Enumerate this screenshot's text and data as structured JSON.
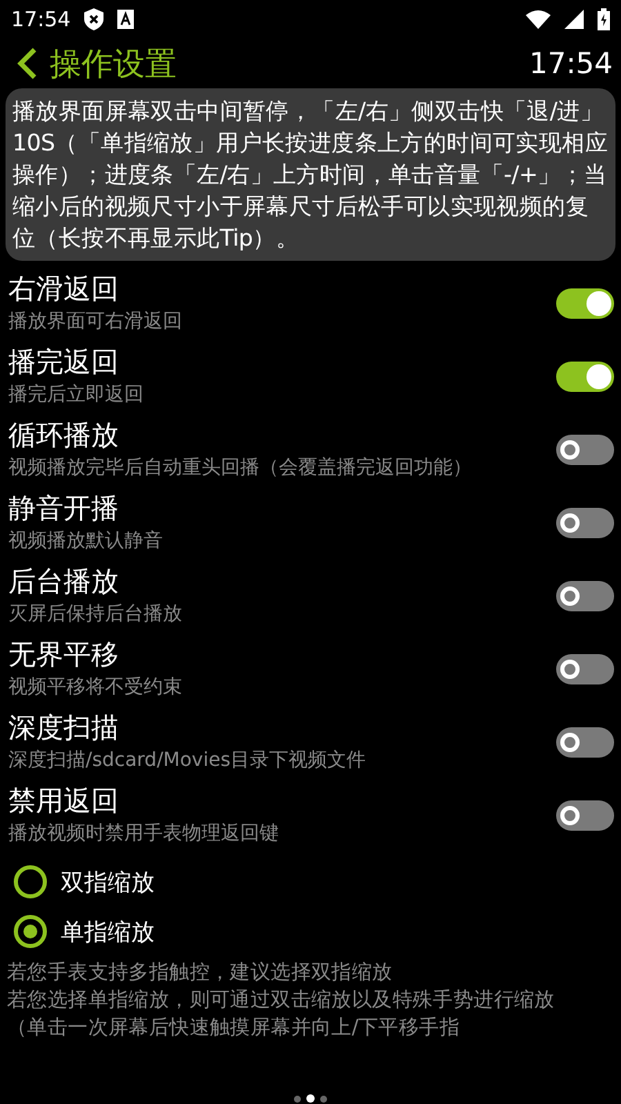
{
  "status_bar": {
    "time": "17:54"
  },
  "header": {
    "title": "操作设置",
    "time": "17:54"
  },
  "tip": "播放界面屏幕双击中间暂停，「左/右」侧双击快「退/进」10S（「单指缩放」用户长按进度条上方的时间可实现相应操作）；进度条「左/右」上方时间，单击音量「-/+」；当缩小后的视频尺寸小于屏幕尺寸后松手可以实现视频的复位（长按不再显示此Tip）。",
  "settings": [
    {
      "title": "右滑返回",
      "subtitle": "播放界面可右滑返回",
      "on": true
    },
    {
      "title": "播完返回",
      "subtitle": "播完后立即返回",
      "on": true
    },
    {
      "title": "循环播放",
      "subtitle": "视频播放完毕后自动重头回播（会覆盖播完返回功能）",
      "on": false
    },
    {
      "title": "静音开播",
      "subtitle": "视频播放默认静音",
      "on": false
    },
    {
      "title": "后台播放",
      "subtitle": "灭屏后保持后台播放",
      "on": false
    },
    {
      "title": "无界平移",
      "subtitle": "视频平移将不受约束",
      "on": false
    },
    {
      "title": "深度扫描",
      "subtitle": "深度扫描/sdcard/Movies目录下视频文件",
      "on": false
    },
    {
      "title": "禁用返回",
      "subtitle": "播放视频时禁用手表物理返回键",
      "on": false
    }
  ],
  "zoom_modes": [
    {
      "label": "双指缩放",
      "selected": false
    },
    {
      "label": "单指缩放",
      "selected": true
    }
  ],
  "notes": [
    "若您手表支持多指触控，建议选择双指缩放",
    "若您选择单指缩放，则可通过双击缩放以及特殊手势进行缩放",
    "（单击一次屏幕后快速触摸屏幕并向上/下平移手指"
  ],
  "page_dots": [
    {
      "selected": false
    },
    {
      "selected": true
    },
    {
      "selected": false
    }
  ]
}
